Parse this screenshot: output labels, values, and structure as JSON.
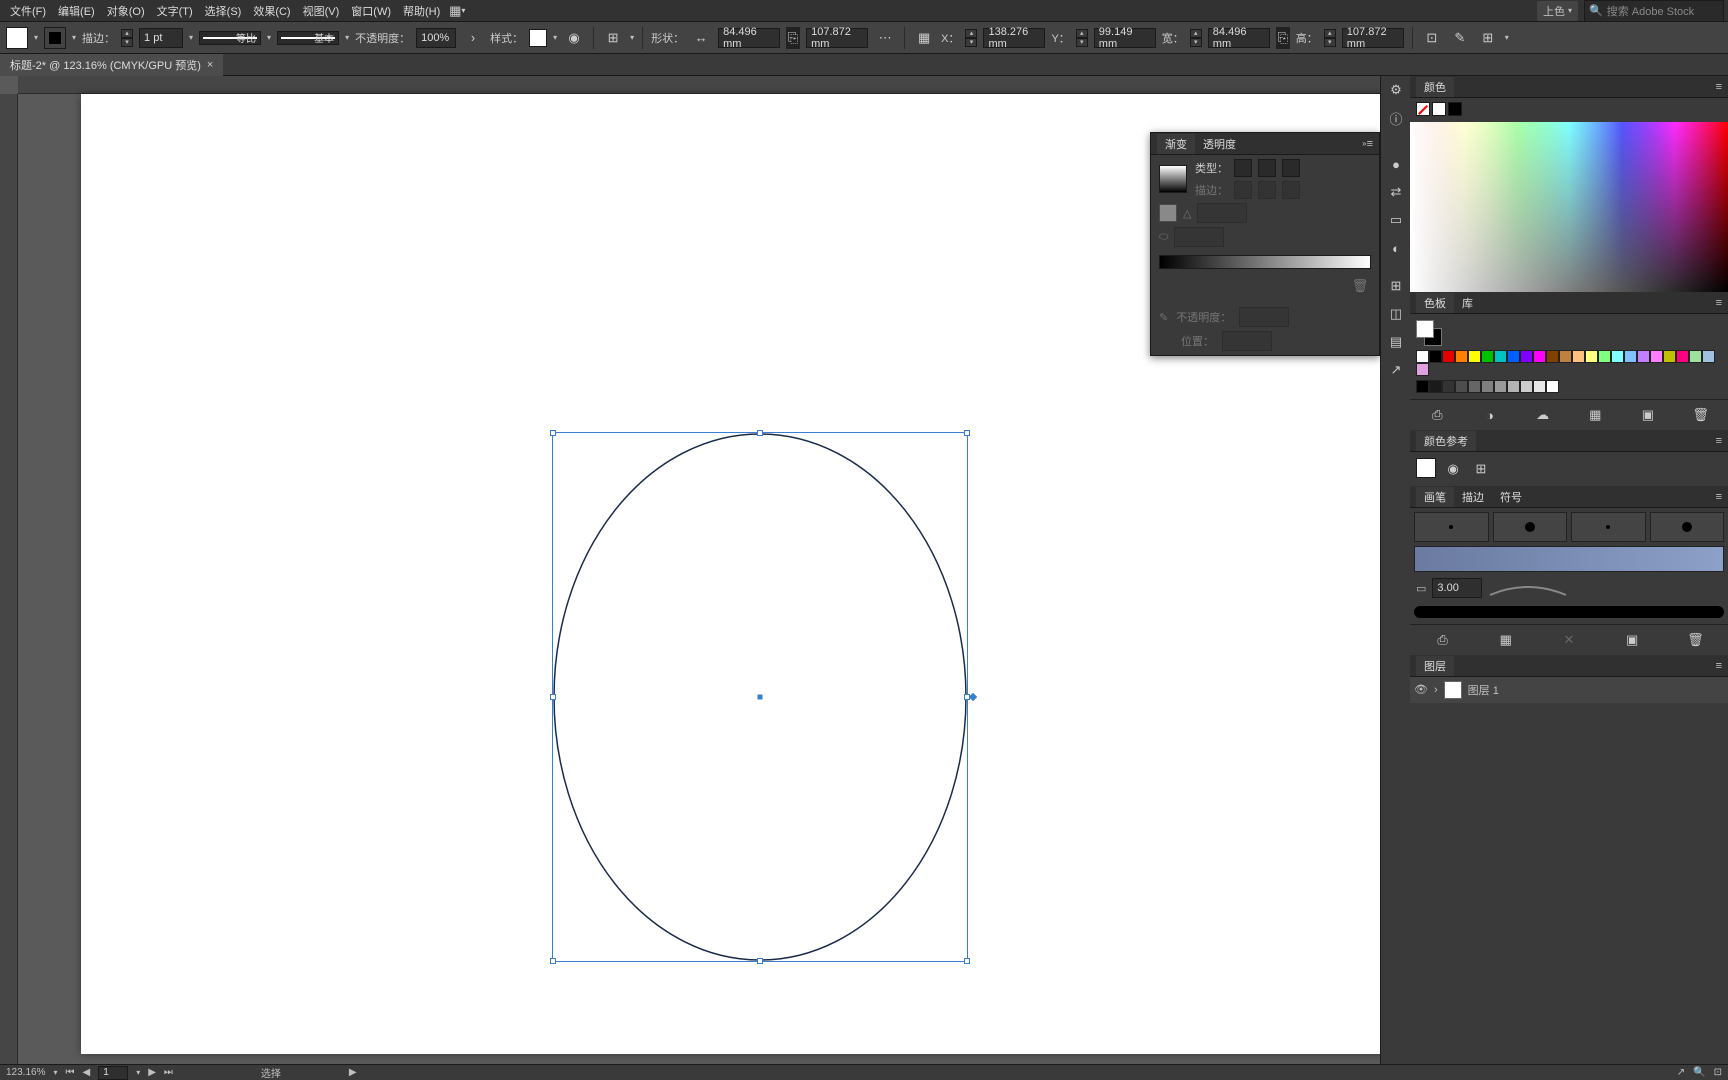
{
  "menu": {
    "file": "文件(F)",
    "edit": "编辑(E)",
    "object": "对象(O)",
    "text": "文字(T)",
    "select": "选择(S)",
    "effect": "效果(C)",
    "view": "视图(V)",
    "window": "窗口(W)",
    "help": "帮助(H)"
  },
  "top_right": {
    "mode": "上色",
    "search_placeholder": "搜索 Adobe Stock"
  },
  "ctrl": {
    "stroke_label": "描边：",
    "stroke_w": "1 pt",
    "profile": "等比",
    "preset": "基本",
    "opacity_label": "不透明度：",
    "opacity": "100%",
    "style_label": "样式：",
    "shape_label": "形状：",
    "w1": "84.496 mm",
    "h1": "107.872 mm",
    "x_label": "X：",
    "x": "138.276 mm",
    "y_label": "Y：",
    "y": "99.149 mm",
    "w_label": "宽：",
    "w": "84.496 mm",
    "h_label": "高：",
    "h": "107.872 mm"
  },
  "tab": {
    "title": "标题-2* @ 123.16% (CMYK/GPU 预览)"
  },
  "grad_panel": {
    "tab1": "渐变",
    "tab2": "透明度",
    "type_label": "类型：",
    "stroke_label": "描边：",
    "opacity_label": "不透明度：",
    "pos_label": "位置："
  },
  "panels": {
    "color": "颜色",
    "swatches": "色板",
    "lib": "库",
    "color_guide": "颜色参考",
    "brushes": "画笔",
    "stroke": "描边",
    "symbols": "符号",
    "stroke_val": "3.00",
    "layers": "图层",
    "layer1": "图层 1"
  },
  "swatch_colors": [
    "#fff",
    "#000",
    "#e40000",
    "#ff8000",
    "#ffff00",
    "#00c000",
    "#00c0c0",
    "#0060ff",
    "#8000ff",
    "#ff00ff",
    "#804000",
    "#c08040",
    "#ffc080",
    "#ffff80",
    "#80ff80",
    "#80ffff",
    "#80c0ff",
    "#c080ff",
    "#ff80ff",
    "#c0c000",
    "#ff0080",
    "#a0e0a0",
    "#a0c0e0",
    "#e0a0e0"
  ],
  "gray_colors": [
    "#000",
    "#1a1a1a",
    "#333",
    "#4d4d4d",
    "#666",
    "#808080",
    "#999",
    "#b3b3b3",
    "#ccc",
    "#e6e6e6",
    "#fff"
  ],
  "status": {
    "zoom": "123.16%",
    "page": "1",
    "tool": "选择"
  }
}
